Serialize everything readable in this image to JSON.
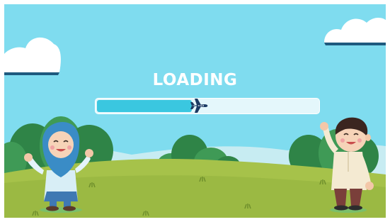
{
  "loading": {
    "label": "LOADING",
    "progress": 0.43
  },
  "colors": {
    "sky": "#7fdcef",
    "bar_fill": "#3ac7e0",
    "bar_track": "#e4f7fb",
    "grass": "#a6c24a",
    "bush": "#3f9a56",
    "plane": "#1b3a63"
  },
  "icons": {
    "progress_marker": "airplane-icon"
  }
}
